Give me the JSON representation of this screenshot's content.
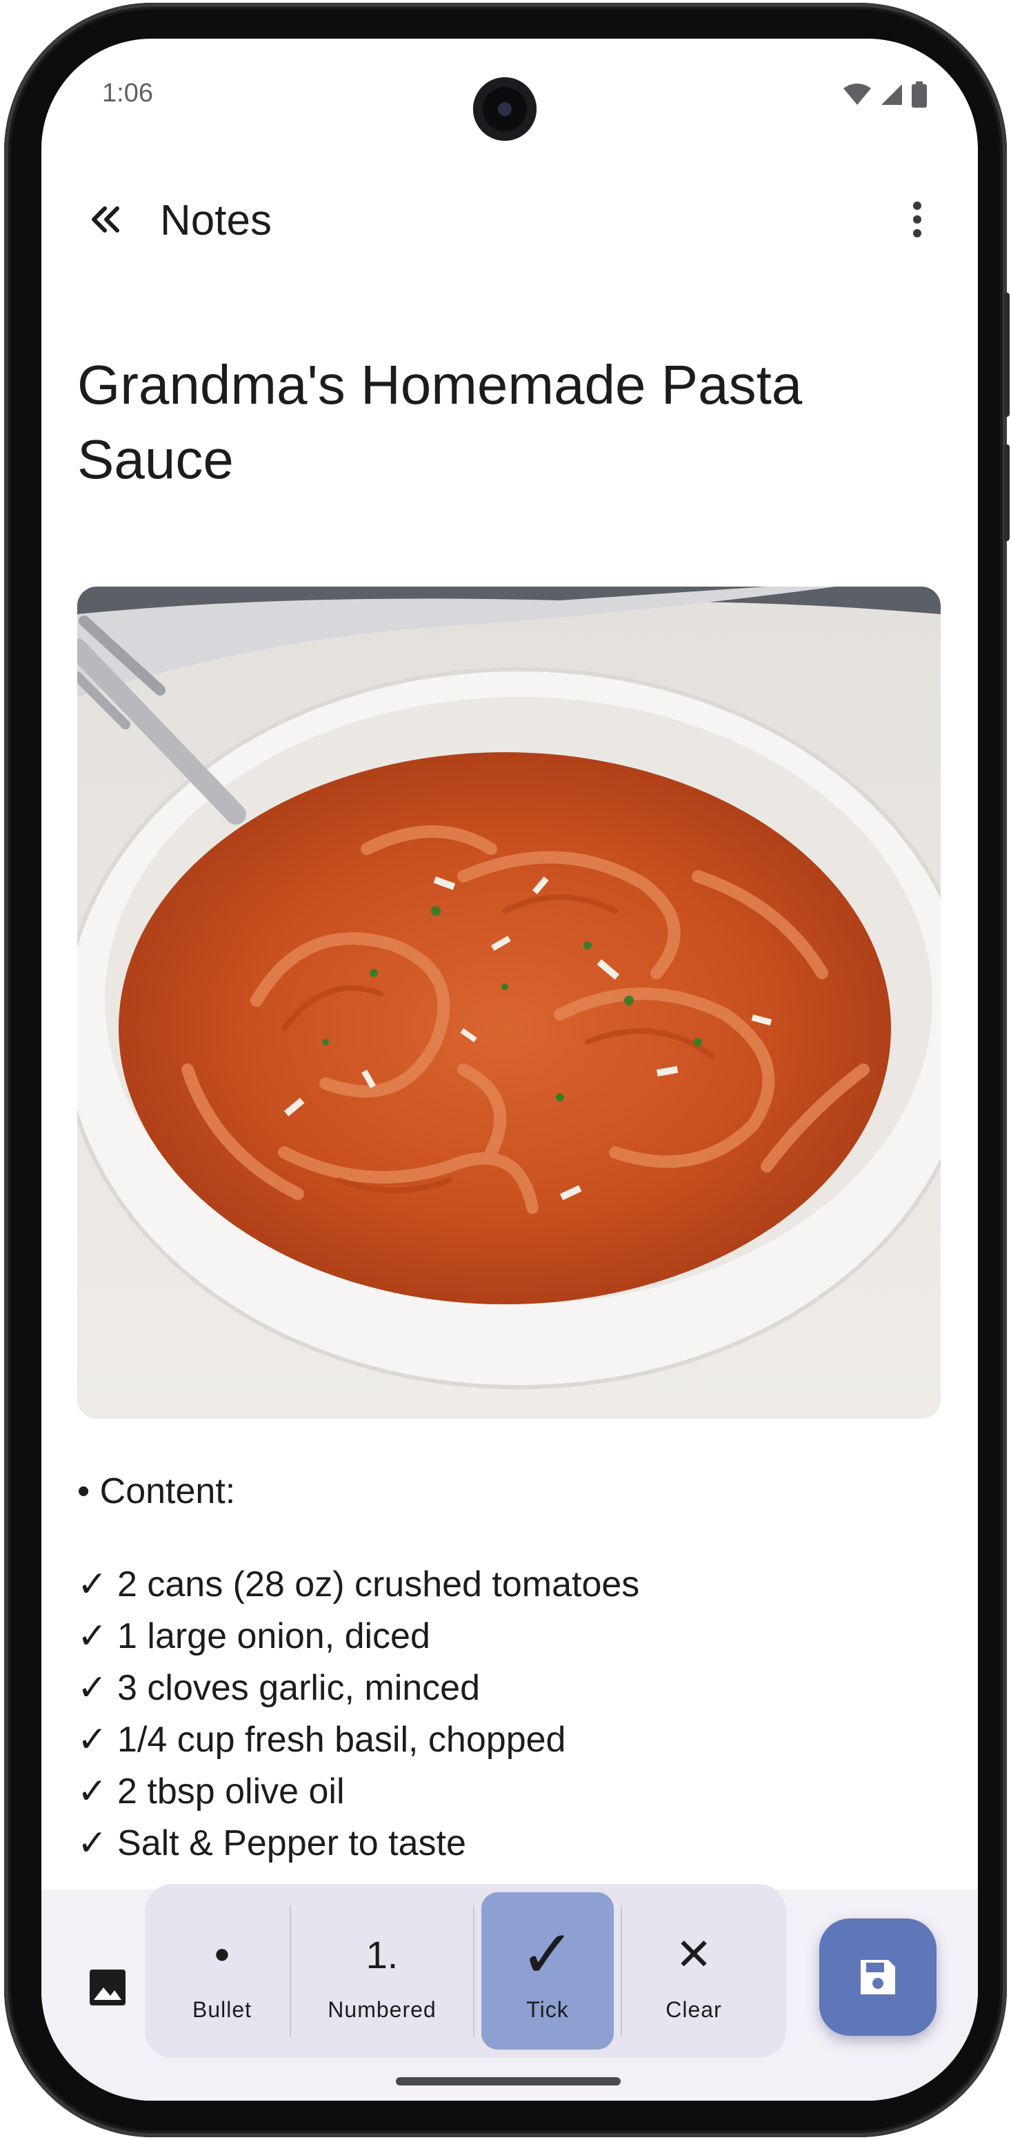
{
  "status_bar": {
    "time": "1:06"
  },
  "app_bar": {
    "title": "Notes"
  },
  "note": {
    "title": "Grandma's Homemade Pasta Sauce",
    "content_header": "• Content:",
    "items": [
      "✓ 2 cans (28 oz) crushed tomatoes",
      "✓ 1 large onion, diced",
      "✓ 3 cloves garlic, minced",
      "✓ 1/4 cup fresh basil, chopped",
      "✓ 2 tbsp olive oil",
      "✓ Salt & Pepper to taste"
    ]
  },
  "toolbar": {
    "format_buttons": [
      {
        "glyph": "•",
        "label": "Bullet",
        "active": false
      },
      {
        "glyph": "1.",
        "label": "Numbered",
        "active": false
      },
      {
        "glyph": "✓",
        "label": "Tick",
        "active": true
      },
      {
        "glyph": "✕",
        "label": "Clear",
        "active": false
      }
    ]
  },
  "icons": {
    "back": "double-chevron-left-icon",
    "menu": "more-vertical-icon",
    "image": "image-icon",
    "save": "floppy-disk-icon"
  },
  "colors": {
    "active_format": "#8e9fd2",
    "save_fab": "#5f76b8",
    "toolbar_bg": "#f3f0f7"
  }
}
